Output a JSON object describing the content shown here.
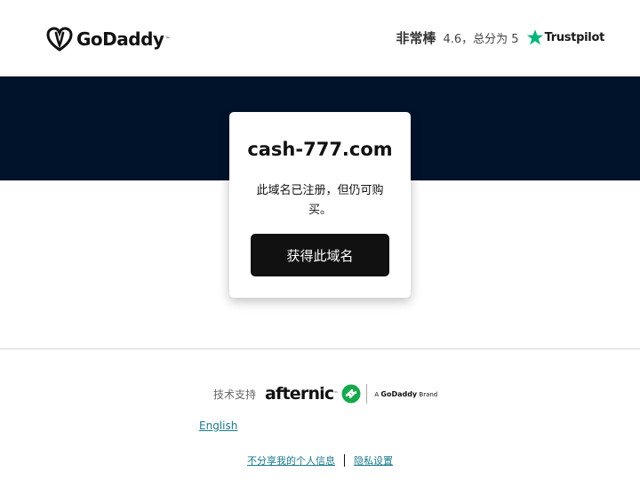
{
  "header": {
    "logo_text": "GoDaddy",
    "logo_tm": "™",
    "rating_word": "非常棒",
    "rating_score": "4.6，总分为 5",
    "trustpilot_text": "Trustpilot"
  },
  "card": {
    "domain": "cash-777.com",
    "message": "此域名已注册，但仍可购买。",
    "button_label": "获得此域名"
  },
  "footer": {
    "powered_label": "技术支持",
    "afternic_text": "afternic",
    "afternic_tm": "™",
    "brand_prefix": "A",
    "brand_name": "GoDaddy",
    "brand_suffix": "Brand",
    "language_link": "English",
    "privacy_optout": "不分享我的个人信息",
    "privacy_settings": "隐私设置"
  },
  "colors": {
    "band": "#00132b",
    "button": "#111111",
    "link": "#1b7a8c",
    "trustpilot_star": "#00b67a",
    "afternic_green": "#17a84b"
  }
}
